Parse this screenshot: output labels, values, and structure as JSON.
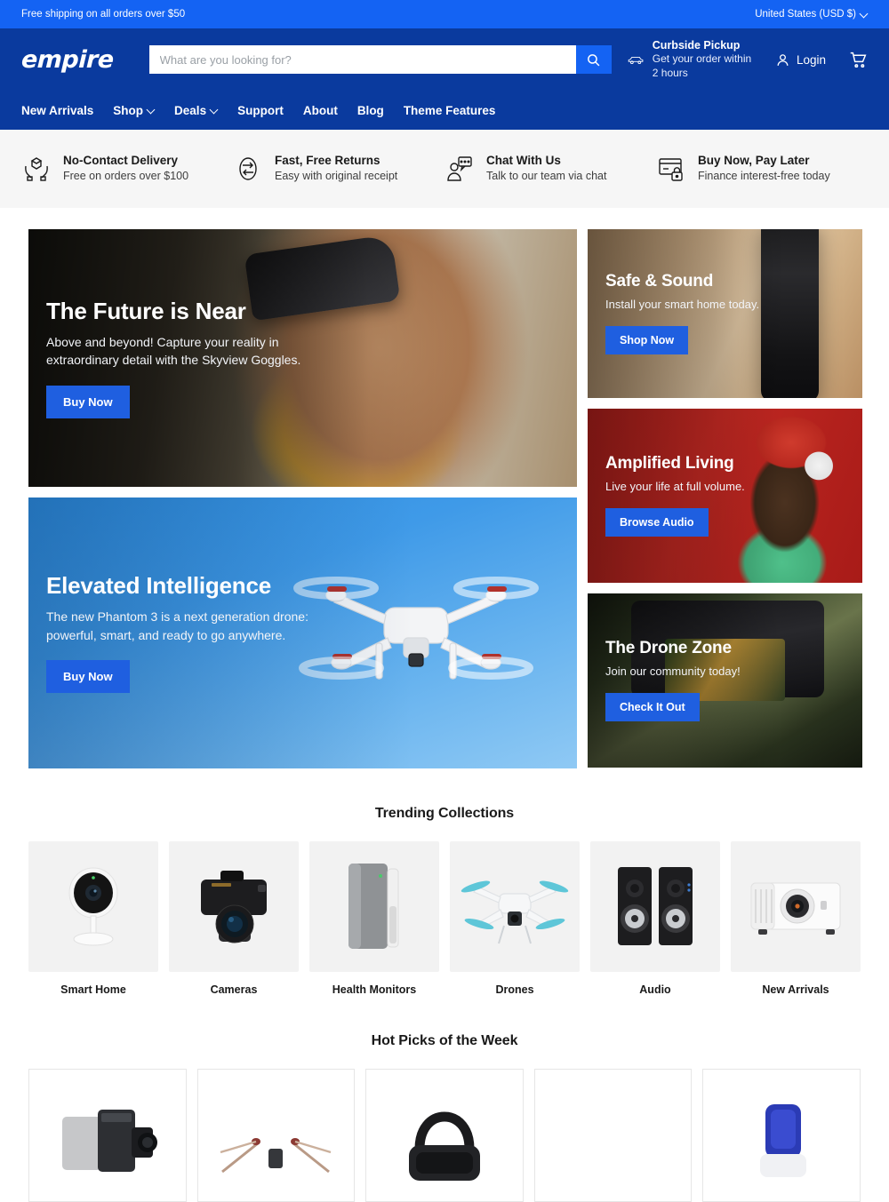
{
  "announcement": {
    "message": "Free shipping on all orders over $50",
    "locale": "United States (USD $)",
    "locale_icon": "chevron-down-icon"
  },
  "header": {
    "logo": "empire",
    "search": {
      "placeholder": "What are you looking for?",
      "value": "",
      "icon": "search-icon"
    },
    "pickup": {
      "icon": "car-icon",
      "title": "Curbside Pickup",
      "subtitle": "Get your order within 2 hours"
    },
    "login": {
      "label": "Login",
      "icon": "user-icon"
    },
    "cart": {
      "icon": "cart-icon"
    },
    "nav": [
      {
        "label": "New Arrivals",
        "has_dropdown": false
      },
      {
        "label": "Shop",
        "has_dropdown": true
      },
      {
        "label": "Deals",
        "has_dropdown": true
      },
      {
        "label": "Support",
        "has_dropdown": false
      },
      {
        "label": "About",
        "has_dropdown": false
      },
      {
        "label": "Blog",
        "has_dropdown": false
      },
      {
        "label": "Theme Features",
        "has_dropdown": false
      }
    ]
  },
  "benefits": [
    {
      "icon": "package-in-hands-icon",
      "title": "No-Contact Delivery",
      "subtitle": "Free on orders over $100"
    },
    {
      "icon": "returns-arrows-icon",
      "title": "Fast, Free Returns",
      "subtitle": "Easy with original receipt"
    },
    {
      "icon": "chat-person-icon",
      "title": "Chat With Us",
      "subtitle": "Talk to our team via chat"
    },
    {
      "icon": "card-lock-icon",
      "title": "Buy Now, Pay Later",
      "subtitle": "Finance interest-free today"
    }
  ],
  "hero": {
    "main": {
      "title": "The Future is Near",
      "description": "Above and beyond! Capture your reality in extraordinary detail with the Skyview Goggles.",
      "cta": "Buy Now"
    },
    "secondary": {
      "title": "Elevated Intelligence",
      "description": "The new Phantom 3 is a next generation drone: powerful, smart, and ready to go anywhere.",
      "cta": "Buy Now"
    },
    "cards": [
      {
        "title": "Safe & Sound",
        "description": "Install your smart home today.",
        "cta": "Shop Now"
      },
      {
        "title": "Amplified Living",
        "description": "Live your life at full volume.",
        "cta": "Browse Audio"
      },
      {
        "title": "The Drone Zone",
        "description": "Join our community today!",
        "cta": "Check It Out"
      }
    ]
  },
  "trending": {
    "title": "Trending Collections",
    "items": [
      {
        "label": "Smart Home",
        "icon": "security-camera-icon"
      },
      {
        "label": "Cameras",
        "icon": "dslr-camera-icon"
      },
      {
        "label": "Health Monitors",
        "icon": "air-purifier-icon"
      },
      {
        "label": "Drones",
        "icon": "quadcopter-drone-icon"
      },
      {
        "label": "Audio",
        "icon": "speaker-pair-icon"
      },
      {
        "label": "New Arrivals",
        "icon": "projector-icon"
      }
    ]
  },
  "hot_picks": {
    "title": "Hot Picks of the Week",
    "items": [
      {
        "icon": "action-camera-icon"
      },
      {
        "icon": "racing-drone-icon"
      },
      {
        "icon": "vr-headset-icon"
      },
      {
        "icon": "blank-product-icon"
      },
      {
        "icon": "blue-controller-icon"
      }
    ]
  },
  "colors": {
    "announce_blue": "#1463f3",
    "header_blue": "#0a3a9e",
    "button_blue": "#1f5fe0",
    "audio_red": "#b5201c",
    "benefits_bg": "#f6f6f6",
    "collection_bg": "#f2f2f2"
  }
}
